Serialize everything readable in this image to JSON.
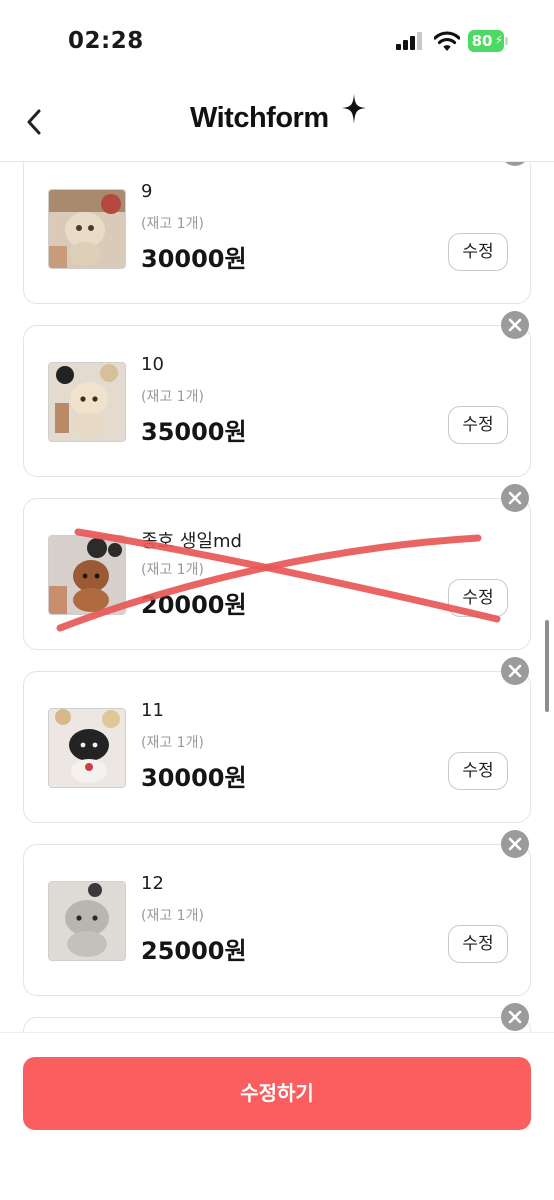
{
  "status_bar": {
    "time": "02:28",
    "battery": "80",
    "icons": [
      "signal-icon",
      "wifi-icon",
      "battery-icon"
    ]
  },
  "header": {
    "logo": "Witchform",
    "back_icon": "chevron-left-icon"
  },
  "items": [
    {
      "name": "9",
      "stock": "(재고 1개)",
      "price": "30000원",
      "edit_label": "수정",
      "crossed_out": false
    },
    {
      "name": "10",
      "stock": "(재고 1개)",
      "price": "35000원",
      "edit_label": "수정",
      "crossed_out": false
    },
    {
      "name": "종호 생일md",
      "stock": "(재고 1개)",
      "price": "20000원",
      "edit_label": "수정",
      "crossed_out": true
    },
    {
      "name": "11",
      "stock": "(재고 1개)",
      "price": "30000원",
      "edit_label": "수정",
      "crossed_out": false
    },
    {
      "name": "12",
      "stock": "(재고 1개)",
      "price": "25000원",
      "edit_label": "수정",
      "crossed_out": false
    }
  ],
  "bottom": {
    "submit_label": "수정하기"
  },
  "colors": {
    "accent": "#fb5e5e",
    "battery": "#4cd964",
    "cross_mark": "#e85757",
    "remove_badge": "#9b9b9b"
  }
}
